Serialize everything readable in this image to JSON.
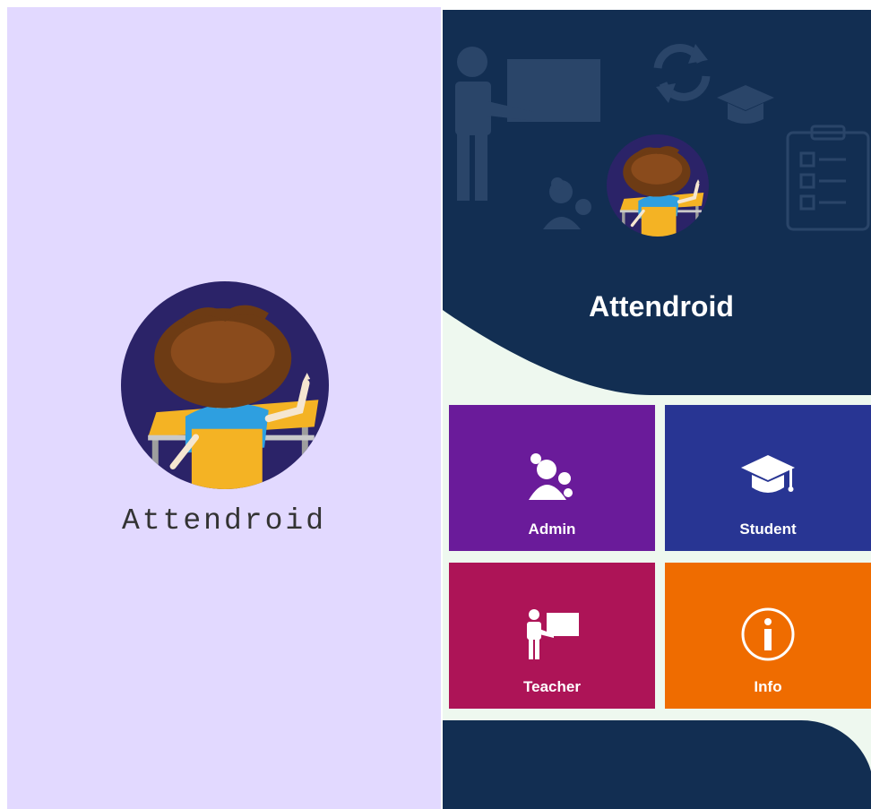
{
  "splash": {
    "app_name": "Attendroid"
  },
  "home": {
    "app_name": "Attendroid",
    "tiles": [
      {
        "label": "Admin",
        "icon": "admin-gears-icon",
        "color": "#6a1b9a"
      },
      {
        "label": "Student",
        "icon": "graduation-cap-icon",
        "color": "#283593"
      },
      {
        "label": "Teacher",
        "icon": "teacher-board-icon",
        "color": "#ad1457"
      },
      {
        "label": "Info",
        "icon": "info-icon",
        "color": "#ef6c00"
      }
    ]
  },
  "colors": {
    "splash_background": "#e2d9ff",
    "home_header": "#122e52",
    "home_background": "#eef8ef"
  }
}
